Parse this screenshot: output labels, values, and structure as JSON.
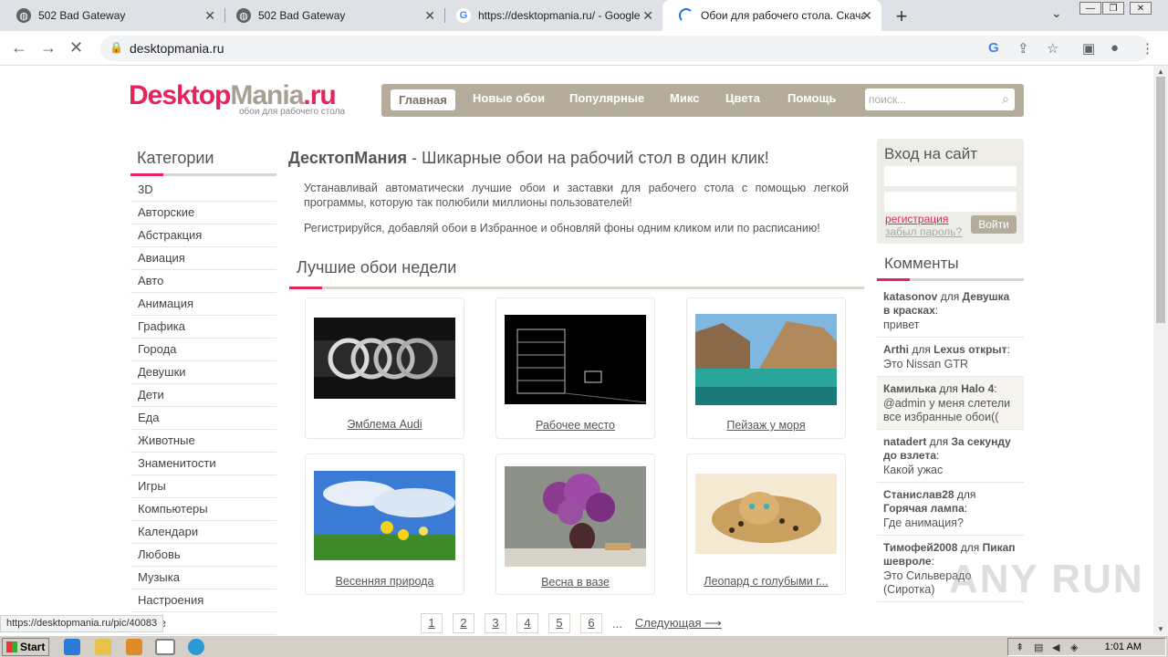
{
  "browser": {
    "tabs": [
      {
        "title": "502 Bad Gateway",
        "icon": "globe-icon"
      },
      {
        "title": "502 Bad Gateway",
        "icon": "globe-icon"
      },
      {
        "title": "https://desktopmania.ru/ - Google Sh",
        "icon": "google-icon"
      },
      {
        "title": "Обои для рабочего стола. Скачать",
        "icon": "loading-icon"
      }
    ],
    "url": "desktopmania.ru",
    "status_url": "https://desktopmania.ru/pic/40083"
  },
  "site": {
    "logo_part1": "Desktop",
    "logo_part2": "Mania",
    "logo_part3": ".ru",
    "logo_sub": "обои для рабочего стола",
    "nav": [
      "Главная",
      "Новые обои",
      "Популярные",
      "Микс",
      "Цвета",
      "Помощь"
    ],
    "search_placeholder": "поиск..."
  },
  "categories": {
    "title": "Категории",
    "items": [
      "3D",
      "Авторские",
      "Абстракция",
      "Авиация",
      "Авто",
      "Анимация",
      "Графика",
      "Города",
      "Девушки",
      "Дети",
      "Еда",
      "Животные",
      "Знаменитости",
      "Игры",
      "Компьютеры",
      "Календари",
      "Любовь",
      "Музыка",
      "Настроения",
      "...кие"
    ]
  },
  "main": {
    "heading_bold": "ДесктопМания",
    "heading_rest": " - Шикарные обои на рабочий стол в один клик!",
    "intro1": "Устанавливай автоматически лучшие обои и заставки для рабочего стола с помощью легкой программы, которую так полюбили миллионы пользователей!",
    "intro2": "Регистрируйся, добавляй обои в Избранное и обновляй фоны одним кликом или по расписанию!",
    "best_title": "Лучшие обои недели",
    "wallpapers": [
      {
        "caption": "Эмблема Audi"
      },
      {
        "caption": "Рабочее место"
      },
      {
        "caption": "Пейзаж у моря"
      },
      {
        "caption": "Весенняя природа"
      },
      {
        "caption": "Весна в вазе"
      },
      {
        "caption": "Леопард с голубыми г..."
      }
    ],
    "pages": [
      "1",
      "2",
      "3",
      "4",
      "5",
      "6"
    ],
    "pages_dots": "...",
    "next_label": "Следующая ⟶"
  },
  "login": {
    "title": "Вход на сайт",
    "register": "регистрация",
    "forgot": "забыл пароль?",
    "button": "Войти"
  },
  "comments": {
    "title": "Комменты",
    "items": [
      {
        "user": "katasonov",
        "for": " для ",
        "target": "Девушка в красках",
        "colon": ":",
        "text": "привет"
      },
      {
        "user": "Arthi",
        "for": " для ",
        "target": "Lexus открыт",
        "colon": ":",
        "text": "Это Nissan GTR"
      },
      {
        "user": "Камилька",
        "for": " для ",
        "target": "Halo 4",
        "colon": ":",
        "text": "@admin у меня слетели все избранные обои(("
      },
      {
        "user": "natadert",
        "for": " для ",
        "target": "За секунду до взлета",
        "colon": ":",
        "text": "Какой ужас"
      },
      {
        "user": "Станислав28",
        "for": " для ",
        "target": "Горячая лампа",
        "colon": ":",
        "text": "Где анимация?"
      },
      {
        "user": "Тимофей2008",
        "for": " для ",
        "target": "Пикап шевроле",
        "colon": ":",
        "text": "Это Сильверадо (Сиротка)"
      }
    ]
  },
  "taskbar": {
    "start": "Start",
    "clock": "1:01 AM"
  },
  "watermark": "ANY RUN"
}
